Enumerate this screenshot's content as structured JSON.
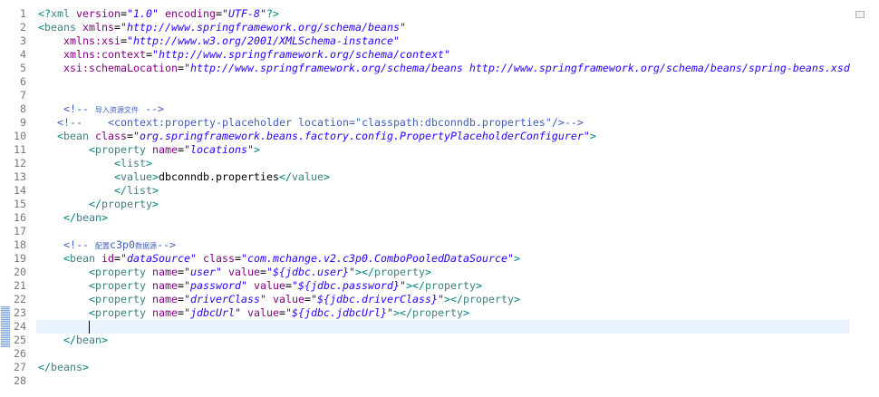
{
  "colors": {
    "bracket": "#008080",
    "tag": "#3F7F7F",
    "attribute": "#7F007F",
    "value": "#2A00FF",
    "comment": "#3F5FBF",
    "text": "#000000",
    "line_number": "#787878",
    "current_line": "#E8F2FE",
    "change_marker": "#7FA7DB"
  },
  "editor": {
    "caret": {
      "line": 24,
      "column": 9
    },
    "changed_lines": {
      "first": 23,
      "last": 25
    },
    "line_numbers": [
      "1",
      "2",
      "3",
      "4",
      "5",
      "6",
      "7",
      "8",
      "9",
      "10",
      "11",
      "12",
      "13",
      "14",
      "15",
      "16",
      "17",
      "18",
      "19",
      "20",
      "21",
      "22",
      "23",
      "24",
      "25",
      "26",
      "27",
      "28"
    ],
    "lines": [
      {
        "tokens": [
          {
            "punct": "<?"
          },
          {
            "tag": "xml"
          },
          {
            "attr": " version"
          },
          {
            "text": "="
          },
          {
            "value": "\"1.0\""
          },
          {
            "attr": " encoding"
          },
          {
            "text": "="
          },
          {
            "value": "\"UTF-8\""
          },
          {
            "punct": "?>"
          }
        ]
      },
      {
        "tokens": [
          {
            "punct": "<"
          },
          {
            "tag": "beans"
          },
          {
            "attr": " xmlns"
          },
          {
            "text": "="
          },
          {
            "value": "\"http://www.springframework.org/schema/beans\""
          }
        ]
      },
      {
        "tokens": [
          {
            "text": "    "
          },
          {
            "attr": "xmlns:xsi"
          },
          {
            "text": "="
          },
          {
            "value": "\"http://www.w3.org/2001/XMLSchema-instance\""
          }
        ]
      },
      {
        "tokens": [
          {
            "text": "    "
          },
          {
            "attr": "xmlns:context"
          },
          {
            "text": "="
          },
          {
            "value": "\"http://www.springframework.org/schema/context\""
          }
        ]
      },
      {
        "tokens": [
          {
            "text": "    "
          },
          {
            "attr": "xsi:schemaLocation"
          },
          {
            "text": "="
          },
          {
            "value": "\"http://www.springframework.org/schema/beans http://www.springframework.org/schema/beans/spring-beans.xsd"
          }
        ]
      },
      {
        "tokens": []
      },
      {
        "tokens": []
      },
      {
        "tokens": [
          {
            "text": "    "
          },
          {
            "comment": "<!-- "
          },
          {
            "comment_cjk": "导入资源文件"
          },
          {
            "comment": " -->"
          }
        ]
      },
      {
        "tokens": [
          {
            "text": "   "
          },
          {
            "comment": "<!--    <context:property-placeholder location=\"classpath:dbconndb.properties\"/>-->"
          }
        ]
      },
      {
        "tokens": [
          {
            "text": "   "
          },
          {
            "punct": "<"
          },
          {
            "tag": "bean"
          },
          {
            "attr": " class"
          },
          {
            "text": "="
          },
          {
            "value": "\"org.springframework.beans.factory.config.PropertyPlaceholderConfigurer\""
          },
          {
            "punct": ">"
          }
        ]
      },
      {
        "tokens": [
          {
            "text": "        "
          },
          {
            "punct": "<"
          },
          {
            "tag": "property"
          },
          {
            "attr": " name"
          },
          {
            "text": "="
          },
          {
            "value": "\"locations\""
          },
          {
            "punct": ">"
          }
        ]
      },
      {
        "tokens": [
          {
            "text": "            "
          },
          {
            "punct": "<"
          },
          {
            "tag": "list"
          },
          {
            "punct": ">"
          }
        ]
      },
      {
        "tokens": [
          {
            "text": "            "
          },
          {
            "punct": "<"
          },
          {
            "tag": "value"
          },
          {
            "punct": ">"
          },
          {
            "text": "dbconndb.properties"
          },
          {
            "punct": "</"
          },
          {
            "tag": "value"
          },
          {
            "punct": ">"
          }
        ]
      },
      {
        "tokens": [
          {
            "text": "            "
          },
          {
            "punct": "</"
          },
          {
            "tag": "list"
          },
          {
            "punct": ">"
          }
        ]
      },
      {
        "tokens": [
          {
            "text": "        "
          },
          {
            "punct": "</"
          },
          {
            "tag": "property"
          },
          {
            "punct": ">"
          }
        ]
      },
      {
        "tokens": [
          {
            "text": "    "
          },
          {
            "punct": "</"
          },
          {
            "tag": "bean"
          },
          {
            "punct": ">"
          }
        ]
      },
      {
        "tokens": []
      },
      {
        "tokens": [
          {
            "text": "    "
          },
          {
            "comment": "<!-- "
          },
          {
            "comment_cjk": "配置"
          },
          {
            "comment": "c3p0"
          },
          {
            "comment_cjk": "数据源"
          },
          {
            "comment": "-->"
          }
        ]
      },
      {
        "tokens": [
          {
            "text": "    "
          },
          {
            "punct": "<"
          },
          {
            "tag": "bean"
          },
          {
            "attr": " id"
          },
          {
            "text": "="
          },
          {
            "value": "\"dataSource\""
          },
          {
            "attr": " class"
          },
          {
            "text": "="
          },
          {
            "value": "\"com.mchange.v2.c3p0.ComboPooledDataSource\""
          },
          {
            "punct": ">"
          }
        ]
      },
      {
        "tokens": [
          {
            "text": "        "
          },
          {
            "punct": "<"
          },
          {
            "tag": "property"
          },
          {
            "attr": " name"
          },
          {
            "text": "="
          },
          {
            "value": "\"user\""
          },
          {
            "attr": " value"
          },
          {
            "text": "="
          },
          {
            "value": "\"${jdbc.user}\""
          },
          {
            "punct": ">"
          },
          {
            "punct": "</"
          },
          {
            "tag": "property"
          },
          {
            "punct": ">"
          }
        ]
      },
      {
        "tokens": [
          {
            "text": "        "
          },
          {
            "punct": "<"
          },
          {
            "tag": "property"
          },
          {
            "attr": " name"
          },
          {
            "text": "="
          },
          {
            "value": "\"password\""
          },
          {
            "attr": " value"
          },
          {
            "text": "="
          },
          {
            "value": "\"${jdbc.password}\""
          },
          {
            "punct": ">"
          },
          {
            "punct": "</"
          },
          {
            "tag": "property"
          },
          {
            "punct": ">"
          }
        ]
      },
      {
        "tokens": [
          {
            "text": "        "
          },
          {
            "punct": "<"
          },
          {
            "tag": "property"
          },
          {
            "attr": " name"
          },
          {
            "text": "="
          },
          {
            "value": "\"driverClass\""
          },
          {
            "attr": " value"
          },
          {
            "text": "="
          },
          {
            "value": "\"${jdbc.driverClass}\""
          },
          {
            "punct": ">"
          },
          {
            "punct": "</"
          },
          {
            "tag": "property"
          },
          {
            "punct": ">"
          }
        ]
      },
      {
        "tokens": [
          {
            "text": "        "
          },
          {
            "punct": "<"
          },
          {
            "tag": "property"
          },
          {
            "attr": " name"
          },
          {
            "text": "="
          },
          {
            "value": "\"jdbcUrl\""
          },
          {
            "attr": " value"
          },
          {
            "text": "="
          },
          {
            "value": "\"${jdbc.jdbcUrl}\""
          },
          {
            "punct": ">"
          },
          {
            "punct": "</"
          },
          {
            "tag": "property"
          },
          {
            "punct": ">"
          }
        ]
      },
      {
        "tokens": [
          {
            "text": "        "
          }
        ]
      },
      {
        "tokens": [
          {
            "text": "    "
          },
          {
            "punct": "</"
          },
          {
            "tag": "bean"
          },
          {
            "punct": ">"
          }
        ]
      },
      {
        "tokens": []
      },
      {
        "tokens": [
          {
            "punct": "</"
          },
          {
            "tag": "beans"
          },
          {
            "punct": ">"
          }
        ]
      },
      {
        "tokens": []
      }
    ]
  }
}
